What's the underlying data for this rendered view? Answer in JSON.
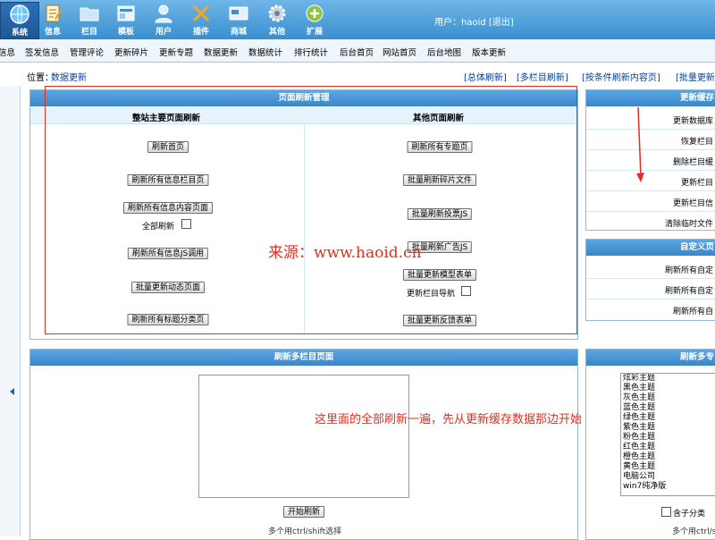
{
  "toolbar": {
    "tools": [
      {
        "label": "系统",
        "icon": "globe-icon"
      },
      {
        "label": "信息",
        "icon": "notepad-icon"
      },
      {
        "label": "栏目",
        "icon": "folder-icon"
      },
      {
        "label": "模板",
        "icon": "template-icon"
      },
      {
        "label": "用户",
        "icon": "user-icon"
      },
      {
        "label": "插件",
        "icon": "tools-icon"
      },
      {
        "label": "商城",
        "icon": "card-icon"
      },
      {
        "label": "其他",
        "icon": "gear-icon"
      },
      {
        "label": "扩展",
        "icon": "plus-icon"
      }
    ],
    "user_prefix": "用户：",
    "username": "haoid",
    "logout": "[退出]"
  },
  "menu": [
    "信息",
    "签发信息",
    "管理评论",
    "更新碎片",
    "更新专题",
    "数据更新",
    "数据统计",
    "排行统计",
    "后台首页",
    "网站首页",
    "后台地图",
    "版本更新"
  ],
  "location": {
    "label": "位置：",
    "link": "数据更新"
  },
  "quick_links": [
    "[总体刷新]",
    "[多栏目刷新]",
    "[按条件刷新内容页]",
    "[批量更新"
  ],
  "refresh_panel": {
    "title": "页面刷新管理",
    "left_title": "整站主要页面刷新",
    "right_title": "其他页面刷新",
    "left_buttons": [
      "刷新首页",
      "刷新所有信息栏目页",
      "刷新所有信息内容页面",
      "刷新所有信息JS调用",
      "批量更新动态页面",
      "刷新所有标题分类页"
    ],
    "all_refresh_label": "全部刷新",
    "right_buttons": [
      "刷新所有专题页",
      "批量刷新碎片文件",
      "批量刷新投票JS",
      "批量刷新广告JS",
      "批量更新模型表单",
      "批量更新反馈表单"
    ],
    "nav_label": "更新栏目导航"
  },
  "cache_panel": {
    "title": "更新缓存",
    "rows": [
      "更新数据库",
      "恢复栏目",
      "删除栏目缓",
      "更新栏目",
      "更新栏目信",
      "清除临时文件"
    ]
  },
  "custom_panel": {
    "title": "自定义页",
    "rows": [
      "刷新所有自定",
      "刷新所有自定",
      "刷新所有自"
    ]
  },
  "multi_panel": {
    "title": "刷新多栏目页面",
    "button": "开始刷新",
    "hint": "多个用ctrl/shift选择"
  },
  "topic_panel": {
    "title": "刷新多专",
    "options": [
      "炫彩主题",
      "黑色主题",
      "灰色主题",
      "蓝色主题",
      "绿色主题",
      "紫色主题",
      "粉色主题",
      "红色主题",
      "橙色主题",
      "黄色主题",
      "电脑公司",
      "win7纯净版"
    ],
    "child_label": "含子分类",
    "hint": "多个用ctrl/sh"
  },
  "watermark": "来源：www.haoid.cn",
  "annotation": "这里面的全部刷新一遍，先从更新缓存数据那边开始",
  "colors": {
    "accent": "#3a8fd0",
    "annotation": "#e03020",
    "link": "#0040a0"
  }
}
